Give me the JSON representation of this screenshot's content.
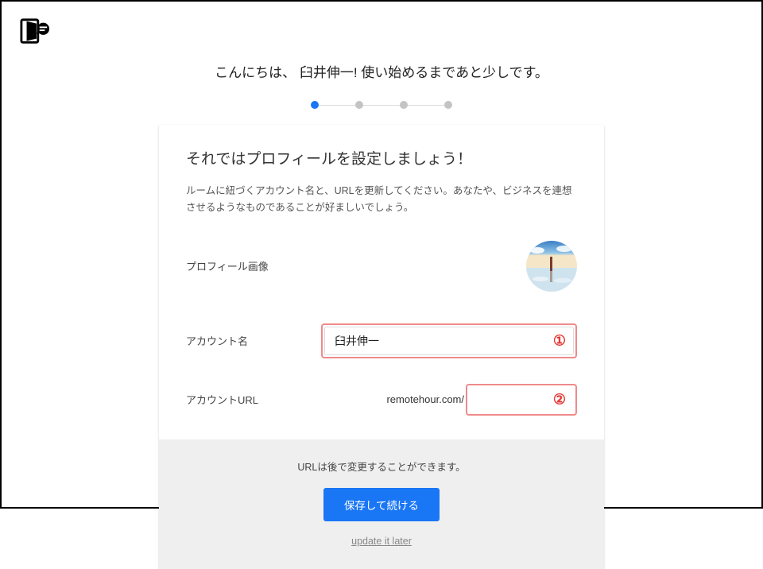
{
  "user_name": "臼井伸一",
  "greeting": "こんにちは、 臼井伸一! 使い始めるまであと少しです。",
  "stepper": {
    "total": 4,
    "current": 1
  },
  "card": {
    "title": "それではプロフィールを設定しましょう！",
    "description": "ルームに紐づくアカウント名と、URLを更新してください。あなたや、ビジネスを連想させるようなものであることが好ましいでしょう。",
    "fields": {
      "avatar_label": "プロフィール画像",
      "account_name_label": "アカウント名",
      "account_name_value": "臼井伸一",
      "account_url_label": "アカウントURL",
      "account_url_prefix": "remotehour.com/",
      "account_url_value": ""
    },
    "annotations": {
      "marker1": "①",
      "marker2": "②"
    }
  },
  "footer": {
    "note": "URLは後で変更することができます。",
    "save_button": "保存して続ける",
    "skip_link": "update it later"
  },
  "colors": {
    "primary": "#1976f5",
    "highlight_border": "#f08a8a",
    "marker": "#e53935"
  }
}
